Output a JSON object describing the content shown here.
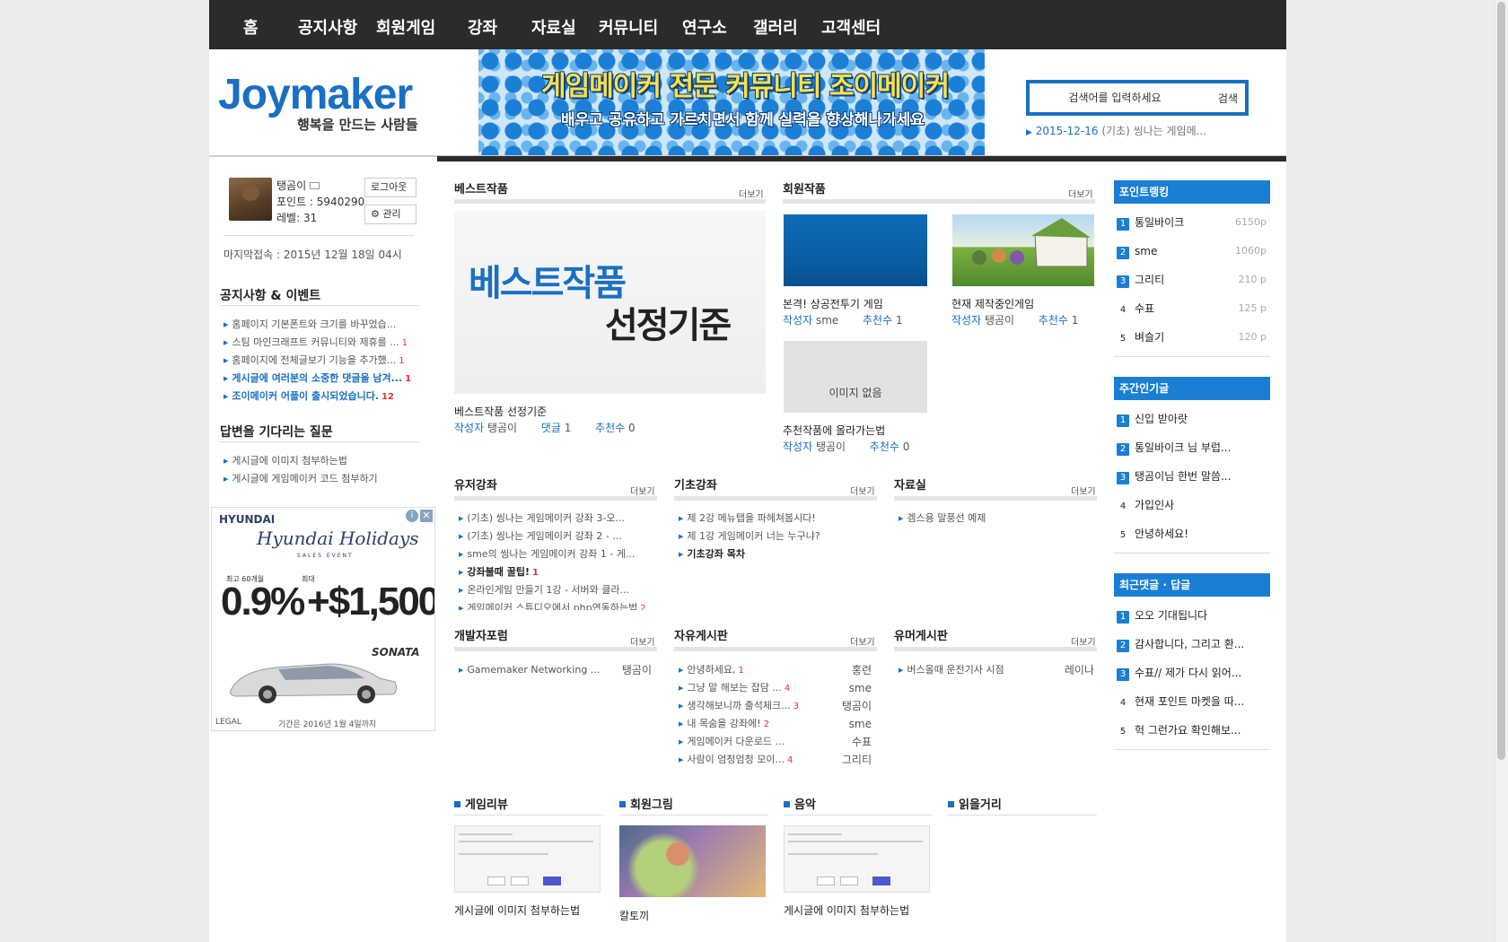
{
  "nav": [
    "홈",
    "공지사항",
    "회원게임",
    "강좌",
    "자료실",
    "커뮤니티",
    "연구소",
    "갤러리",
    "고객센터"
  ],
  "logo": {
    "text": "Joymaker",
    "subtitle": "행복을 만드는 사람들"
  },
  "banner": {
    "title": "게임메이커 전문 커뮤니티 조이메이커",
    "subtitle": "배우고 공유하고 가르치면서 함께 실력을 향상해나가세요"
  },
  "search": {
    "placeholder": "검색어를 입력하세요",
    "button": "검색",
    "note_date": "2015-12-16",
    "note_text": "(기초) 씽나는 게임메..."
  },
  "user": {
    "name": "탱곰이",
    "points": "포인트 : 5940290",
    "level": "레벨: 31",
    "logout": "로그아웃",
    "manage": "관리",
    "last_login": "마지막접속 : 2015년 12월 18일 04시"
  },
  "notices": {
    "title": "공지사항 & 이벤트",
    "items": [
      {
        "text": "홈페이지 기본폰트와 크기를 바꾸었습...",
        "count": "",
        "hl": false
      },
      {
        "text": "스팀 마인크래프트 커뮤니티와 제휴를 ...",
        "count": "1",
        "hl": false
      },
      {
        "text": "홈페이지에 전체글보기 기능을 추가했...",
        "count": "1",
        "hl": false
      },
      {
        "text": "게시글에 여러분의 소중한 댓글을 남겨...",
        "count": "1",
        "hl": true
      },
      {
        "text": "조이메이커 어플이 출시되었습니다.",
        "count": "12",
        "hl": true
      }
    ]
  },
  "questions": {
    "title": "답변을 기다리는 질문",
    "items": [
      "게시글에 이미지 첨부하는법",
      "게시글에 게임메이커 코드 첨부하기"
    ]
  },
  "ad": {
    "brand": "HYUNDAI",
    "script": "Hyundai Holidays",
    "event": "SALES EVENT",
    "label1": "최고 60개월",
    "label2": "최대",
    "rate": "0.9%",
    "amount": "+$1,500",
    "model": "SONATA",
    "legal": "LEGAL",
    "until": "기간은 2016년 1월 4일까지"
  },
  "best": {
    "title": "베스트작품",
    "more": "더보기",
    "img_line1": "베스트작품",
    "img_line2": "선정기준",
    "caption": "베스트작품 선정기준",
    "author_label": "작성자",
    "author": "탱곰이",
    "comment_label": "댓글",
    "comments": "1",
    "rec_label": "추천수",
    "rec": "0"
  },
  "member_works": {
    "title": "회원작품",
    "more": "더보기",
    "no_image": "이미지 없음",
    "items": [
      {
        "caption": "본격! 상공전투기 게임",
        "author": "sme",
        "rec": "1"
      },
      {
        "caption": "현재 제작중인게임",
        "author": "탱곰이",
        "rec": "1"
      },
      {
        "caption": "추천작품에 올라가는법",
        "author": "탱곰이",
        "rec": "0"
      }
    ],
    "author_label": "작성자",
    "rec_label": "추천수"
  },
  "boards": {
    "user_lecture": {
      "title": "유저강좌",
      "more": "더보기",
      "items": [
        {
          "text": "(기초) 씽나는 게임메이커 강좌 3-오...",
          "count": ""
        },
        {
          "text": "(기초) 씽나는 게임메이커 강좌 2 - ...",
          "count": ""
        },
        {
          "text": "sme의 씽나는 게임메이커 강좌 1 - 게...",
          "count": ""
        },
        {
          "text": "강좌불때 꿀팁!",
          "count": "1",
          "b": true
        },
        {
          "text": "온라인게임 만들기 1강 - 서버와 클라...",
          "count": ""
        },
        {
          "text": "게임메이커 스튜디오에서 php연동하는법",
          "count": "2"
        }
      ]
    },
    "basic_lecture": {
      "title": "기초강좌",
      "more": "더보기",
      "items": [
        {
          "text": "제 2강 메뉴탭을 파헤쳐봅시다!",
          "count": ""
        },
        {
          "text": "제 1강 게임메이커 너는 누구냐?",
          "count": ""
        },
        {
          "text": "기초강좌 목차",
          "count": "",
          "b": true
        }
      ]
    },
    "archive": {
      "title": "자료실",
      "more": "더보기",
      "items": [
        {
          "text": "겜스용 말풍선 예제",
          "count": ""
        }
      ]
    },
    "dev_forum": {
      "title": "개발자포럼",
      "more": "더보기",
      "items": [
        {
          "text": "Gamemaker Networking ...",
          "count": "",
          "author": "탱곰이"
        }
      ]
    },
    "free_board": {
      "title": "자유게시판",
      "more": "더보기",
      "items": [
        {
          "text": "안녕하세요,",
          "count": "1",
          "author": "홍련"
        },
        {
          "text": "그냥 말 해보는 잡담 ...",
          "count": "4",
          "author": "sme"
        },
        {
          "text": "생각해보니까 출석체크...",
          "count": "3",
          "author": "탱곰이"
        },
        {
          "text": "내 목숨을 강좌에!",
          "count": "2",
          "author": "sme"
        },
        {
          "text": "게임메이커 다운로드 ...",
          "count": "",
          "author": "수표"
        },
        {
          "text": "사람이 엄청엄청 모이...",
          "count": "4",
          "author": "그리티"
        }
      ]
    },
    "humor_board": {
      "title": "유머게시판",
      "more": "더보기",
      "items": [
        {
          "text": "버스올때 운전기사 시점",
          "count": "",
          "author": "레이나"
        }
      ]
    }
  },
  "galleries": [
    {
      "title": "게임리뷰",
      "caption": "게시글에 이미지 첨부하는법"
    },
    {
      "title": "회원그림",
      "caption": "칼토끼"
    },
    {
      "title": "음악",
      "caption": "게시글에 이미지 첨부하는법"
    },
    {
      "title": "읽을거리",
      "caption": ""
    }
  ],
  "ranking": {
    "title": "포인트랭킹",
    "items": [
      {
        "n": "1",
        "name": "통일바이크",
        "pts": "6150p"
      },
      {
        "n": "2",
        "name": "sme",
        "pts": "1060p"
      },
      {
        "n": "3",
        "name": "그리티",
        "pts": "210  p"
      },
      {
        "n": "4",
        "name": "수표",
        "pts": "125  p"
      },
      {
        "n": "5",
        "name": "벼슬기",
        "pts": "120  p"
      }
    ]
  },
  "weekly": {
    "title": "주간인기글",
    "items": [
      {
        "n": "1",
        "name": "신입 받아랏"
      },
      {
        "n": "2",
        "name": "통일바이크 님 부럽..."
      },
      {
        "n": "3",
        "name": "탱곰이님 한번 말씀..."
      },
      {
        "n": "4",
        "name": "가입인사"
      },
      {
        "n": "5",
        "name": "안녕하세요!"
      }
    ]
  },
  "recent_comments": {
    "title": "최근댓글 · 답글",
    "items": [
      {
        "n": "1",
        "name": "오오 기대됩니다"
      },
      {
        "n": "2",
        "name": "감사합니다, 그리고 환..."
      },
      {
        "n": "3",
        "name": "수표// 제가 다시 읽어..."
      },
      {
        "n": "4",
        "name": "현재 포인트 마켓을 따..."
      },
      {
        "n": "5",
        "name": "헉 그런가요 확인해보..."
      }
    ]
  },
  "colors": {
    "accent": "#1a7fd4",
    "nav_bg": "#2b2b2b",
    "highlight": "#1a6fc4",
    "count_red": "#e0303a"
  },
  "icons": {
    "mail": "mail-icon",
    "gear": "gear-icon",
    "bullet": "triangle-right-icon"
  }
}
